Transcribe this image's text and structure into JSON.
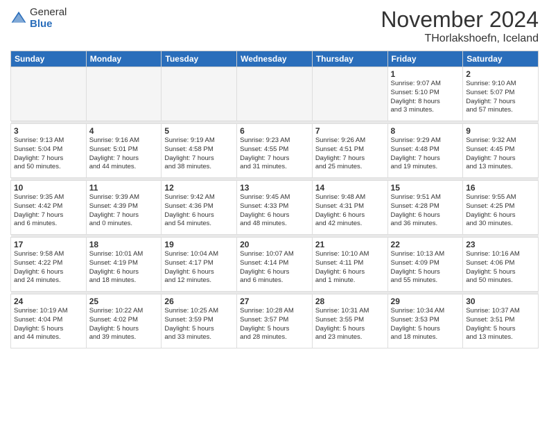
{
  "logo": {
    "general": "General",
    "blue": "Blue"
  },
  "title": "November 2024",
  "location": "THorlakshoefn, Iceland",
  "weekdays": [
    "Sunday",
    "Monday",
    "Tuesday",
    "Wednesday",
    "Thursday",
    "Friday",
    "Saturday"
  ],
  "weeks": [
    [
      {
        "day": "",
        "info": ""
      },
      {
        "day": "",
        "info": ""
      },
      {
        "day": "",
        "info": ""
      },
      {
        "day": "",
        "info": ""
      },
      {
        "day": "",
        "info": ""
      },
      {
        "day": "1",
        "info": "Sunrise: 9:07 AM\nSunset: 5:10 PM\nDaylight: 8 hours\nand 3 minutes."
      },
      {
        "day": "2",
        "info": "Sunrise: 9:10 AM\nSunset: 5:07 PM\nDaylight: 7 hours\nand 57 minutes."
      }
    ],
    [
      {
        "day": "3",
        "info": "Sunrise: 9:13 AM\nSunset: 5:04 PM\nDaylight: 7 hours\nand 50 minutes."
      },
      {
        "day": "4",
        "info": "Sunrise: 9:16 AM\nSunset: 5:01 PM\nDaylight: 7 hours\nand 44 minutes."
      },
      {
        "day": "5",
        "info": "Sunrise: 9:19 AM\nSunset: 4:58 PM\nDaylight: 7 hours\nand 38 minutes."
      },
      {
        "day": "6",
        "info": "Sunrise: 9:23 AM\nSunset: 4:55 PM\nDaylight: 7 hours\nand 31 minutes."
      },
      {
        "day": "7",
        "info": "Sunrise: 9:26 AM\nSunset: 4:51 PM\nDaylight: 7 hours\nand 25 minutes."
      },
      {
        "day": "8",
        "info": "Sunrise: 9:29 AM\nSunset: 4:48 PM\nDaylight: 7 hours\nand 19 minutes."
      },
      {
        "day": "9",
        "info": "Sunrise: 9:32 AM\nSunset: 4:45 PM\nDaylight: 7 hours\nand 13 minutes."
      }
    ],
    [
      {
        "day": "10",
        "info": "Sunrise: 9:35 AM\nSunset: 4:42 PM\nDaylight: 7 hours\nand 6 minutes."
      },
      {
        "day": "11",
        "info": "Sunrise: 9:39 AM\nSunset: 4:39 PM\nDaylight: 7 hours\nand 0 minutes."
      },
      {
        "day": "12",
        "info": "Sunrise: 9:42 AM\nSunset: 4:36 PM\nDaylight: 6 hours\nand 54 minutes."
      },
      {
        "day": "13",
        "info": "Sunrise: 9:45 AM\nSunset: 4:33 PM\nDaylight: 6 hours\nand 48 minutes."
      },
      {
        "day": "14",
        "info": "Sunrise: 9:48 AM\nSunset: 4:31 PM\nDaylight: 6 hours\nand 42 minutes."
      },
      {
        "day": "15",
        "info": "Sunrise: 9:51 AM\nSunset: 4:28 PM\nDaylight: 6 hours\nand 36 minutes."
      },
      {
        "day": "16",
        "info": "Sunrise: 9:55 AM\nSunset: 4:25 PM\nDaylight: 6 hours\nand 30 minutes."
      }
    ],
    [
      {
        "day": "17",
        "info": "Sunrise: 9:58 AM\nSunset: 4:22 PM\nDaylight: 6 hours\nand 24 minutes."
      },
      {
        "day": "18",
        "info": "Sunrise: 10:01 AM\nSunset: 4:19 PM\nDaylight: 6 hours\nand 18 minutes."
      },
      {
        "day": "19",
        "info": "Sunrise: 10:04 AM\nSunset: 4:17 PM\nDaylight: 6 hours\nand 12 minutes."
      },
      {
        "day": "20",
        "info": "Sunrise: 10:07 AM\nSunset: 4:14 PM\nDaylight: 6 hours\nand 6 minutes."
      },
      {
        "day": "21",
        "info": "Sunrise: 10:10 AM\nSunset: 4:11 PM\nDaylight: 6 hours\nand 1 minute."
      },
      {
        "day": "22",
        "info": "Sunrise: 10:13 AM\nSunset: 4:09 PM\nDaylight: 5 hours\nand 55 minutes."
      },
      {
        "day": "23",
        "info": "Sunrise: 10:16 AM\nSunset: 4:06 PM\nDaylight: 5 hours\nand 50 minutes."
      }
    ],
    [
      {
        "day": "24",
        "info": "Sunrise: 10:19 AM\nSunset: 4:04 PM\nDaylight: 5 hours\nand 44 minutes."
      },
      {
        "day": "25",
        "info": "Sunrise: 10:22 AM\nSunset: 4:02 PM\nDaylight: 5 hours\nand 39 minutes."
      },
      {
        "day": "26",
        "info": "Sunrise: 10:25 AM\nSunset: 3:59 PM\nDaylight: 5 hours\nand 33 minutes."
      },
      {
        "day": "27",
        "info": "Sunrise: 10:28 AM\nSunset: 3:57 PM\nDaylight: 5 hours\nand 28 minutes."
      },
      {
        "day": "28",
        "info": "Sunrise: 10:31 AM\nSunset: 3:55 PM\nDaylight: 5 hours\nand 23 minutes."
      },
      {
        "day": "29",
        "info": "Sunrise: 10:34 AM\nSunset: 3:53 PM\nDaylight: 5 hours\nand 18 minutes."
      },
      {
        "day": "30",
        "info": "Sunrise: 10:37 AM\nSunset: 3:51 PM\nDaylight: 5 hours\nand 13 minutes."
      }
    ]
  ]
}
